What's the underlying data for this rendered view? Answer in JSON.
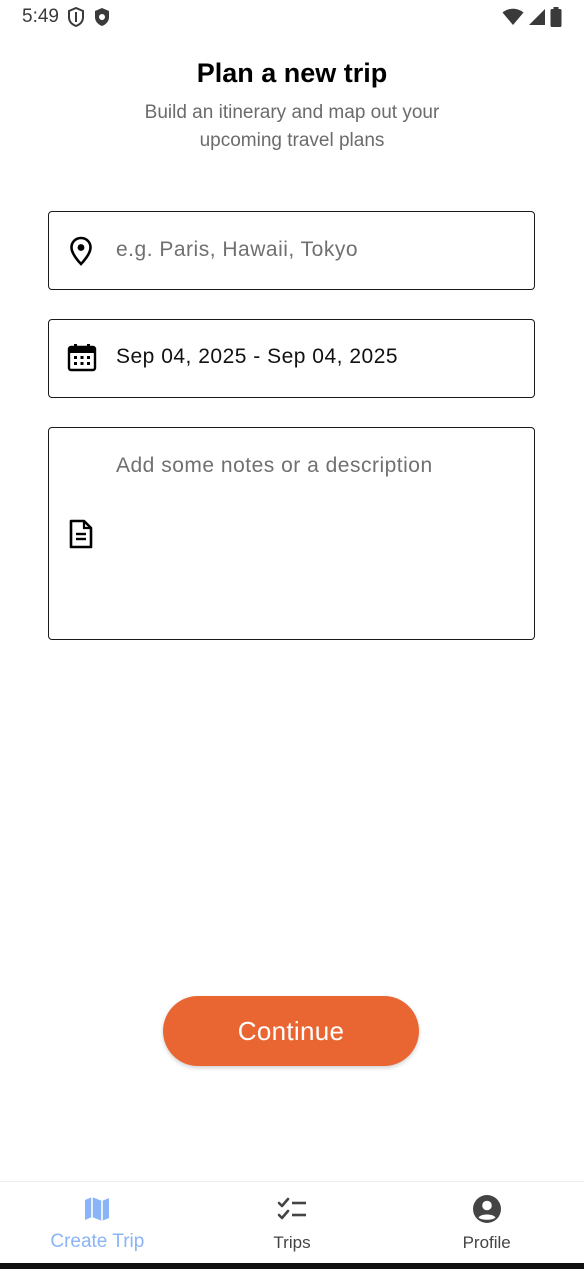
{
  "status_bar": {
    "time": "5:49",
    "left_icons": [
      "shield-outline-icon",
      "shield-filled-icon"
    ],
    "right_icons": [
      "wifi-icon",
      "signal-icon",
      "battery-icon"
    ]
  },
  "header": {
    "title": "Plan a new trip",
    "subtitle": "Build an itinerary and map out your upcoming travel plans"
  },
  "form": {
    "location": {
      "icon": "location-pin-icon",
      "placeholder": "e.g. Paris, Hawaii, Tokyo",
      "value": ""
    },
    "dates": {
      "icon": "calendar-icon",
      "value": "Sep 04, 2025 - Sep 04, 2025"
    },
    "notes": {
      "icon": "document-icon",
      "placeholder": "Add some notes or a description",
      "value": ""
    }
  },
  "continue_label": "Continue",
  "colors": {
    "accent": "#e96633",
    "active_nav": "#8ab4f8"
  },
  "bottom_nav": {
    "items": [
      {
        "label": "Create Trip",
        "icon": "map-icon",
        "active": true
      },
      {
        "label": "Trips",
        "icon": "checklist-icon",
        "active": false
      },
      {
        "label": "Profile",
        "icon": "account-circle-icon",
        "active": false
      }
    ]
  }
}
